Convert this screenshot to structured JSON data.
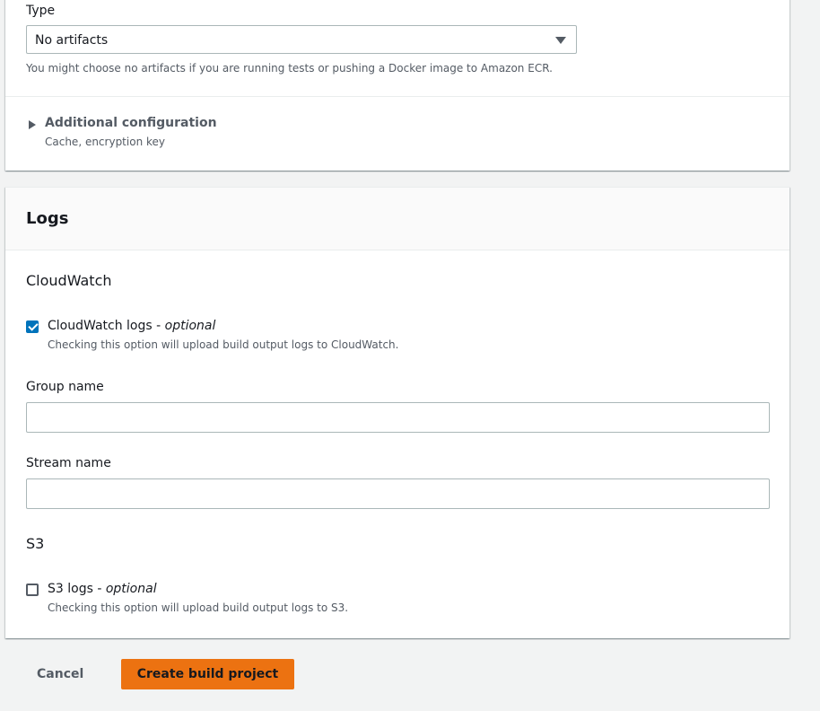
{
  "artifacts": {
    "type_label": "Type",
    "type_value": "No artifacts",
    "type_hint": "You might choose no artifacts if you are running tests or pushing a Docker image to Amazon ECR.",
    "additional_title": "Additional configuration",
    "additional_sub": "Cache, encryption key"
  },
  "logs": {
    "title": "Logs",
    "cloudwatch": {
      "section": "CloudWatch",
      "checkbox_label": "CloudWatch logs - ",
      "checkbox_optional": "optional",
      "checked": true,
      "checkbox_hint": "Checking this option will upload build output logs to CloudWatch.",
      "group_label": "Group name",
      "group_value": "",
      "stream_label": "Stream name",
      "stream_value": ""
    },
    "s3": {
      "section": "S3",
      "checkbox_label": "S3 logs - ",
      "checkbox_optional": "optional",
      "checked": false,
      "checkbox_hint": "Checking this option will upload build output logs to S3."
    }
  },
  "footer": {
    "cancel_label": "Cancel",
    "create_label": "Create build project"
  },
  "colors": {
    "primary": "#ec7211",
    "checkbox_checked": "#0073bb"
  },
  "icons": {
    "select_caret": "caret-down-icon",
    "expander": "caret-right-icon",
    "checkmark": "checkmark-icon"
  }
}
